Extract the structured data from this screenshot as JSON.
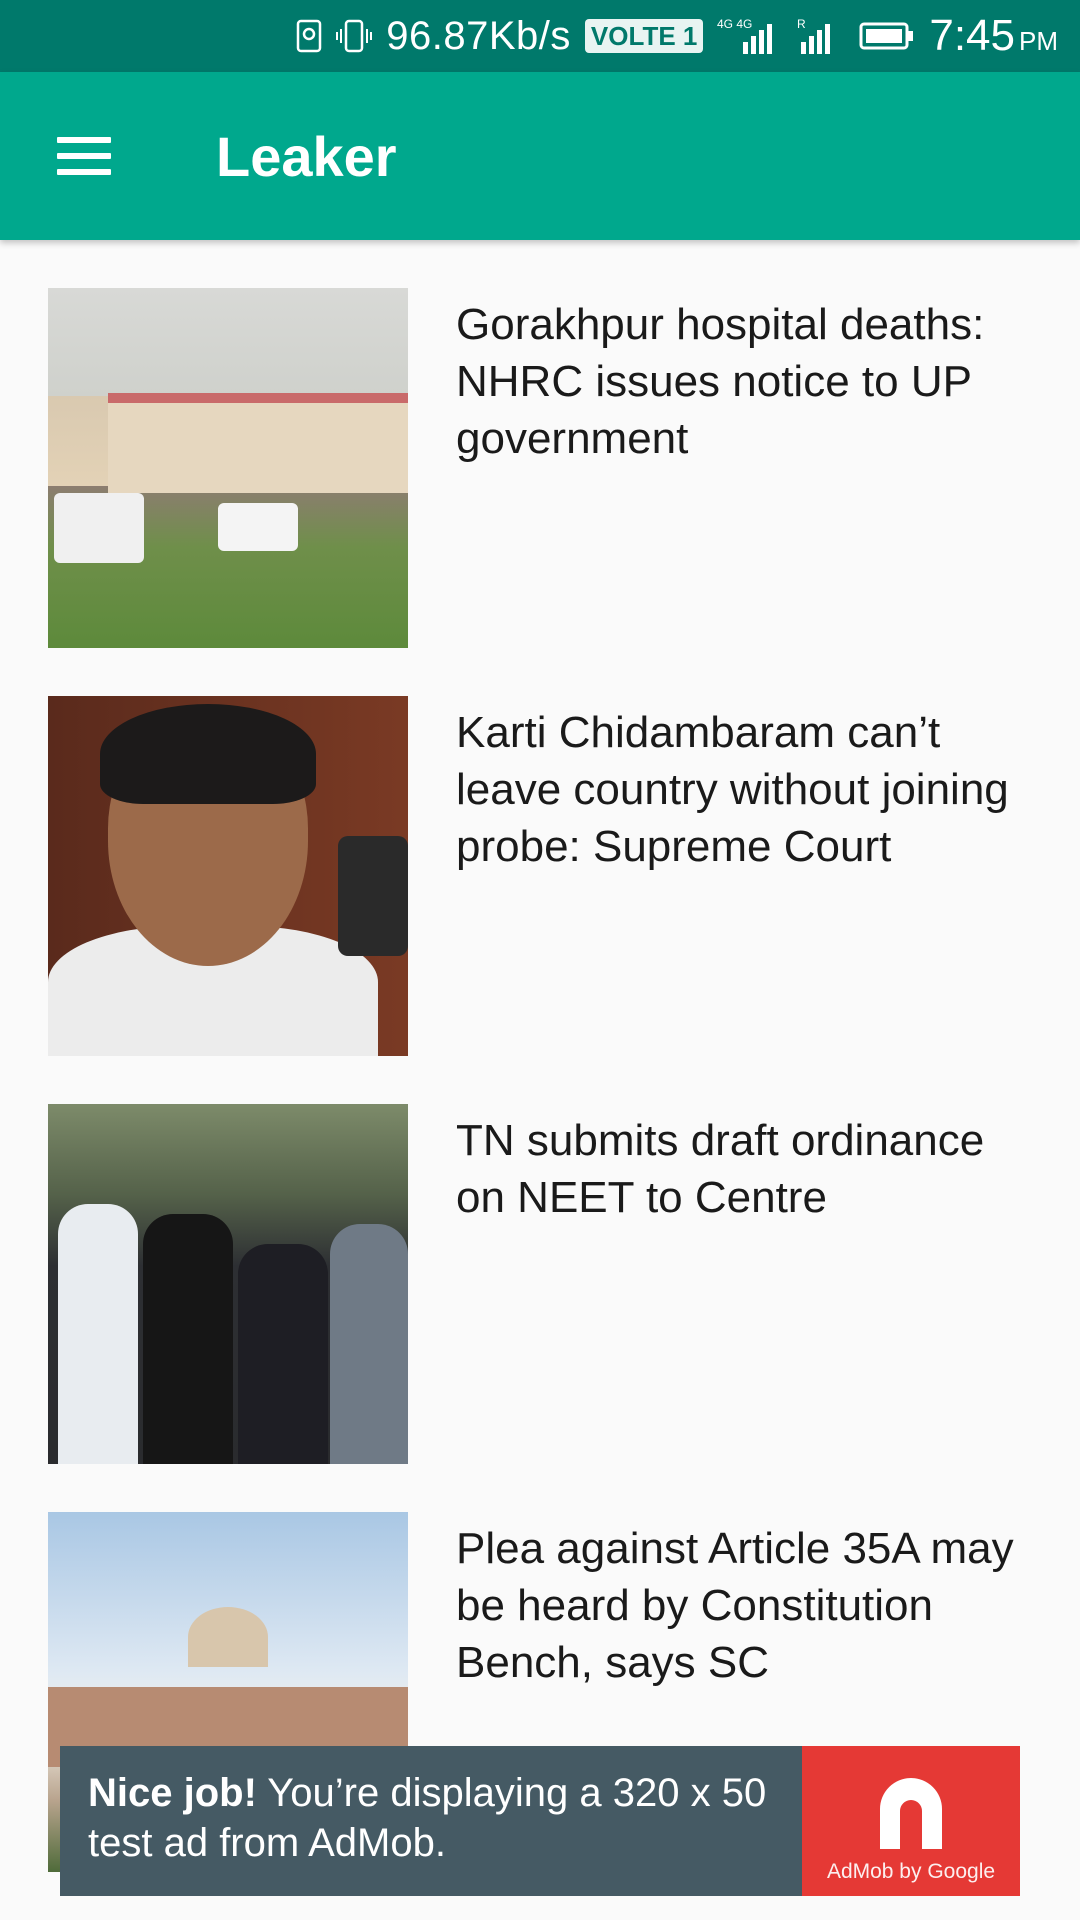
{
  "status_bar": {
    "speed": "96.87Kb/s",
    "volte": "VOLTE 1",
    "network": "4G",
    "time": "7:45",
    "ampm": "PM"
  },
  "app_bar": {
    "title": "Leaker",
    "menu_icon": "hamburger-menu-icon"
  },
  "articles": [
    {
      "headline": "Gorakhpur hospital deaths: NHRC issues notice to UP government",
      "image": "hospital-building-photo"
    },
    {
      "headline": "Karti Chidambaram can’t leave country without joining probe: Supreme Court",
      "image": "man-portrait-photo"
    },
    {
      "headline": "TN submits draft ordinance on NEET to Centre",
      "image": "crowd-photo"
    },
    {
      "headline": "Plea against Article 35A may be heard by Constitution Bench, says SC",
      "image": "supreme-court-building-photo"
    }
  ],
  "ad_banner": {
    "lead": "Nice job!",
    "text": " You’re displaying a 320 x 50 test ad from AdMob.",
    "logo_caption": "AdMob by Google"
  },
  "colors": {
    "status_bar": "#00796b",
    "app_bar": "#00a88d",
    "background": "#fafafa",
    "ad_background": "#455a64",
    "ad_logo_background": "#e53935"
  }
}
